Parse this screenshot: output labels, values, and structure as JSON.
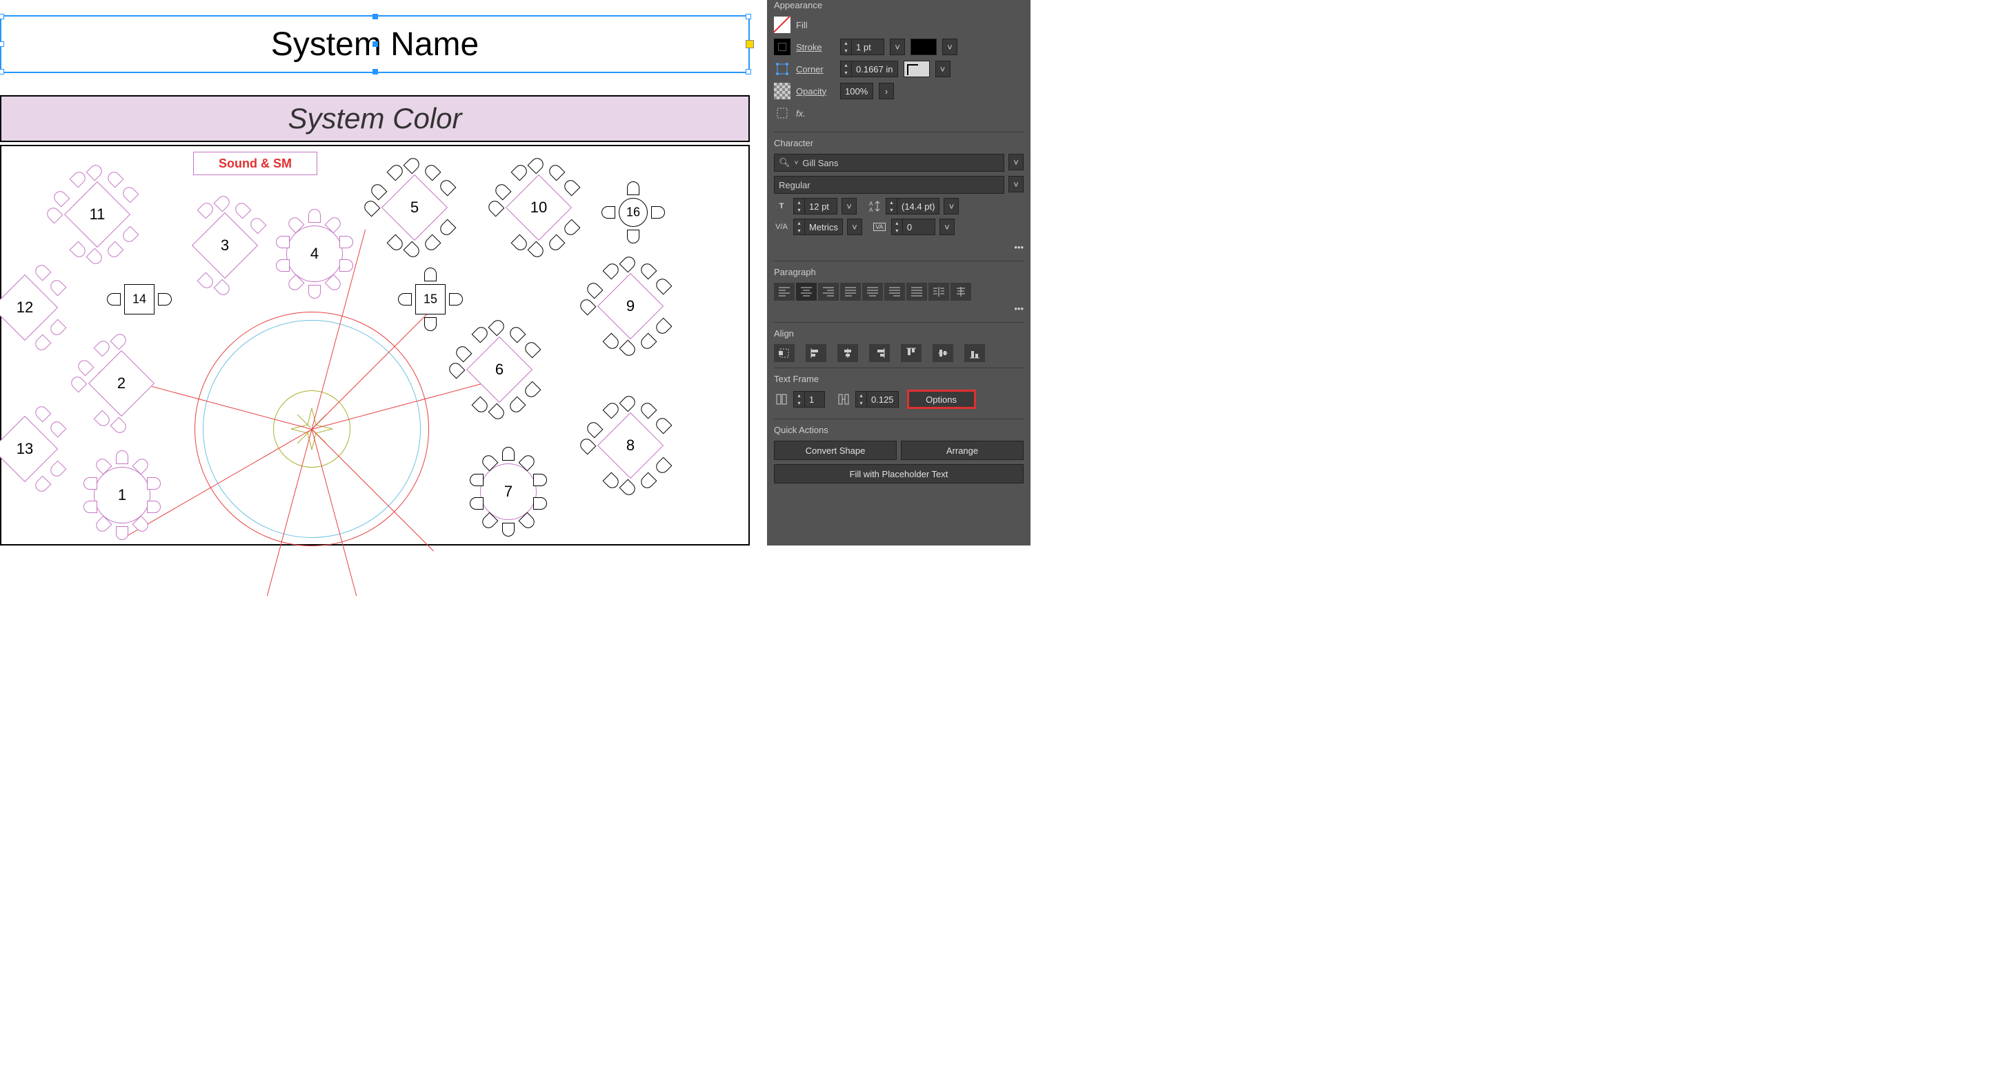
{
  "canvas": {
    "title": "System Name",
    "subtitle": "System Color",
    "sound_label": "Sound & SM",
    "tables": [
      "1",
      "2",
      "3",
      "4",
      "5",
      "6",
      "7",
      "8",
      "9",
      "10",
      "11",
      "12",
      "13",
      "14",
      "15",
      "16"
    ]
  },
  "appearance": {
    "section": "Appearance",
    "fill_label": "Fill",
    "stroke_label": "Stroke",
    "stroke_value": "1 pt",
    "corner_label": "Corner",
    "corner_value": "0.1667 in",
    "opacity_label": "Opacity",
    "opacity_value": "100%",
    "fx_label": "fx."
  },
  "character": {
    "section": "Character",
    "font": "Gill Sans",
    "style": "Regular",
    "size": "12 pt",
    "leading": "(14.4 pt)",
    "kerning": "Metrics",
    "tracking": "0"
  },
  "paragraph": {
    "section": "Paragraph"
  },
  "align": {
    "section": "Align"
  },
  "text_frame": {
    "section": "Text Frame",
    "columns": "1",
    "gutter": "0.125",
    "options": "Options"
  },
  "quick_actions": {
    "section": "Quick Actions",
    "convert": "Convert Shape",
    "arrange": "Arrange",
    "fill_placeholder": "Fill with Placeholder Text"
  }
}
